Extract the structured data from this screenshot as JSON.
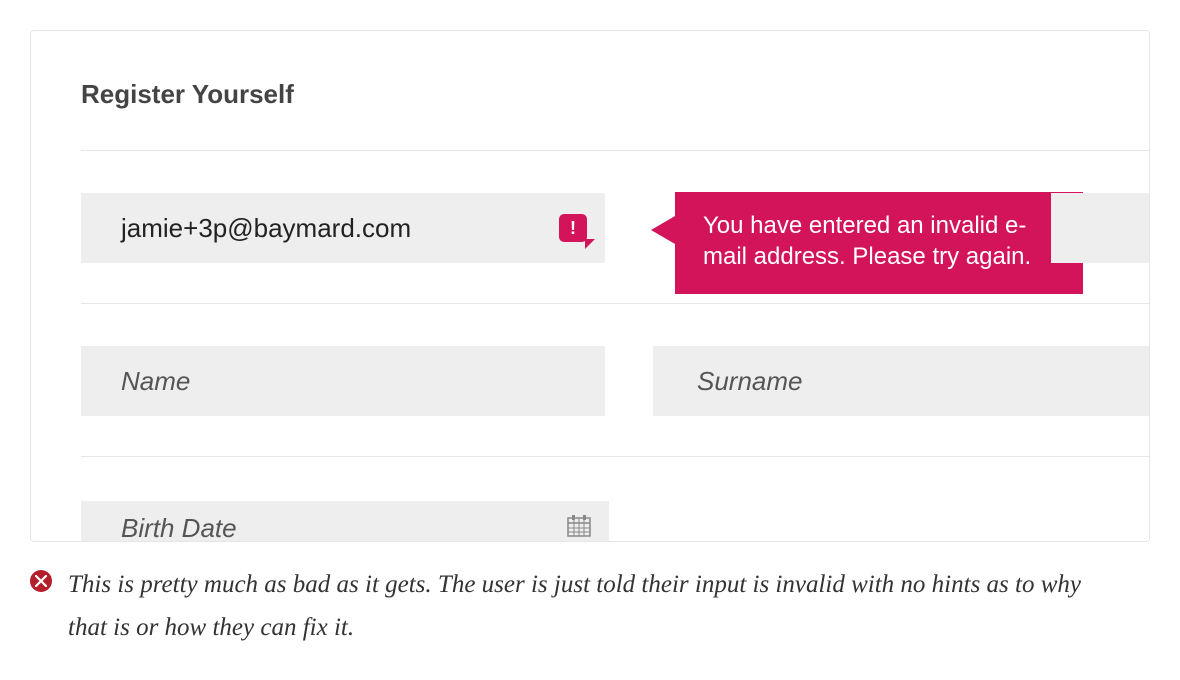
{
  "form": {
    "title": "Register Yourself",
    "email": {
      "value": "jamie+3p@baymard.com",
      "error_icon_glyph": "!",
      "error_message": "You have entered an invalid e-mail address. Please try again."
    },
    "name_placeholder": "Name",
    "surname_placeholder": "Surname",
    "birth_date_placeholder": "Birth Date"
  },
  "caption": {
    "icon_glyph": "✕",
    "text": "This is pretty much as bad as it gets. The user is just told their input is invalid with no hints as to why that is or how they can fix it."
  },
  "colors": {
    "accent_error": "#d4145a",
    "caption_icon": "#b3202c"
  }
}
